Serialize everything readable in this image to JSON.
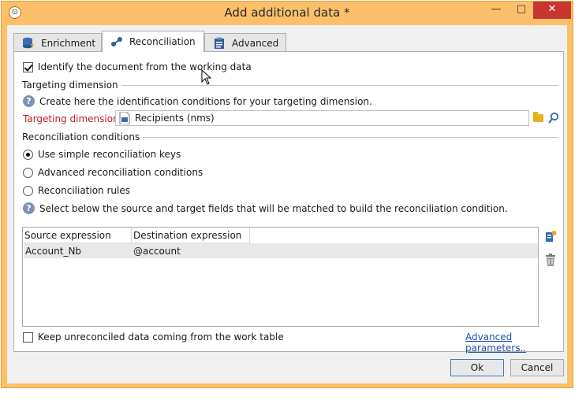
{
  "window": {
    "title": "Add additional data *",
    "controls": {
      "minimize": "—",
      "maximize": "□",
      "close": "✕"
    }
  },
  "tabs": [
    {
      "label": "Enrichment",
      "icon": "database-icon"
    },
    {
      "label": "Reconciliation",
      "icon": "link-icon"
    },
    {
      "label": "Advanced",
      "icon": "clipboard-icon"
    }
  ],
  "identify": {
    "label": "Identify the document from the working data",
    "checked": true
  },
  "targeting": {
    "section_label": "Targeting dimension",
    "help_text": "Create here the identification conditions for your targeting dimension.",
    "field_label": "Targeting dimension:",
    "field_value": "Recipients (nms)"
  },
  "reconciliation": {
    "section_label": "Reconciliation conditions",
    "options": [
      {
        "label": "Use simple reconciliation keys",
        "selected": true
      },
      {
        "label": "Advanced reconciliation conditions",
        "selected": false
      },
      {
        "label": "Reconciliation rules",
        "selected": false
      }
    ],
    "help_text": "Select below the source and target fields that will be matched to build the reconciliation condition."
  },
  "grid": {
    "columns": [
      "Source expression",
      "Destination expression"
    ],
    "rows": [
      [
        "Account_Nb",
        "@account"
      ]
    ]
  },
  "keep_unreconciled": {
    "label": "Keep unreconciled data coming from the work table",
    "checked": false
  },
  "advanced_link": "Advanced parameters..",
  "buttons": {
    "ok": "Ok",
    "cancel": "Cancel"
  },
  "colors": {
    "frame": "#fdc06a",
    "close": "#c7372f",
    "required_label": "#c0202a",
    "link": "#1f4fb0"
  }
}
